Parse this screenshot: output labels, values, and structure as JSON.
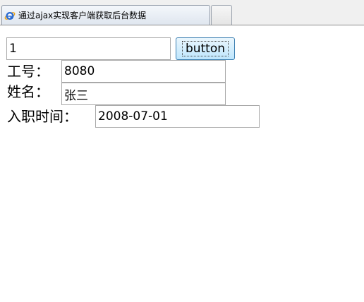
{
  "browser": {
    "tab_title": "通过ajax实现客户端获取后台数据",
    "tab_icon": "ie-icon"
  },
  "form": {
    "id_input_value": "1",
    "button_label": "button",
    "employee_no_label": "工号：",
    "employee_no_value": "8080",
    "name_label": "姓名：",
    "name_value": "张三",
    "hire_date_label": "入职时间：",
    "hire_date_value": "2008-07-01"
  },
  "colors": {
    "button_border": "#3c7fb1",
    "ie_icon_blue": "#2a6bd1",
    "ie_icon_ring": "#e8a31c"
  }
}
